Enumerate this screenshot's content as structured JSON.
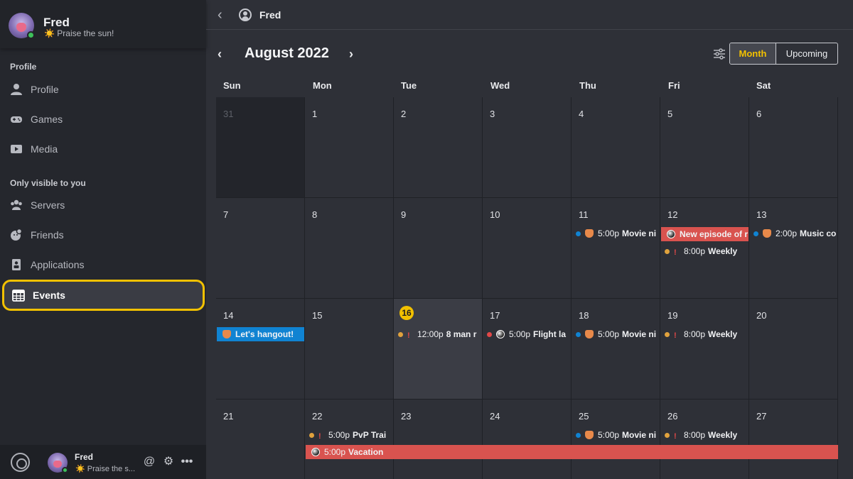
{
  "sidebar": {
    "profile": {
      "name": "Fred",
      "status": "Praise the sun!",
      "status_icon": "☀️"
    },
    "sections": [
      {
        "label": "Profile",
        "items": [
          {
            "label": "Profile",
            "icon": "person-icon"
          },
          {
            "label": "Games",
            "icon": "gamepad-icon"
          },
          {
            "label": "Media",
            "icon": "media-icon"
          }
        ]
      },
      {
        "label": "Only visible to you",
        "items": [
          {
            "label": "Servers",
            "icon": "servers-icon"
          },
          {
            "label": "Friends",
            "icon": "friends-icon"
          },
          {
            "label": "Applications",
            "icon": "applications-icon"
          },
          {
            "label": "Events",
            "icon": "calendar-icon",
            "active": true
          }
        ]
      }
    ],
    "footer": {
      "name": "Fred",
      "status": "Praise the s..."
    }
  },
  "topbar": {
    "name": "Fred"
  },
  "calendar": {
    "month_title": "August 2022",
    "view_options": [
      "Month",
      "Upcoming"
    ],
    "selected_view": "Month",
    "weekdays": [
      "Sun",
      "Mon",
      "Tue",
      "Wed",
      "Thu",
      "Fri",
      "Sat"
    ],
    "weeks": [
      [
        "31",
        "1",
        "2",
        "3",
        "4",
        "5",
        "6"
      ],
      [
        "7",
        "8",
        "9",
        "10",
        "11",
        "12",
        "13"
      ],
      [
        "14",
        "15",
        "16",
        "17",
        "18",
        "19",
        "20"
      ],
      [
        "21",
        "22",
        "23",
        "24",
        "25",
        "26",
        "27"
      ]
    ],
    "today": "16",
    "events": {
      "w2_thu": {
        "time": "5:00p",
        "title": "Movie ni"
      },
      "w2_fri_bar": {
        "title": "New episode of r"
      },
      "w2_fri": {
        "time": "8:00p",
        "title": "Weekly"
      },
      "w2_sat": {
        "time": "2:00p",
        "title": "Music co"
      },
      "w3_sun_bar": {
        "title": "Let's hangout!"
      },
      "w3_tue": {
        "time": "12:00p",
        "title": "8 man r"
      },
      "w3_wed": {
        "time": "5:00p",
        "title": "Flight la"
      },
      "w3_thu": {
        "time": "5:00p",
        "title": "Movie ni"
      },
      "w3_fri": {
        "time": "8:00p",
        "title": "Weekly"
      },
      "w4_mon": {
        "time": "5:00p",
        "title": "PvP Trai"
      },
      "w4_thu": {
        "time": "5:00p",
        "title": "Movie ni"
      },
      "w4_fri": {
        "time": "8:00p",
        "title": "Weekly"
      },
      "w4_vacation": {
        "time": "5:00p",
        "title": "Vacation"
      }
    },
    "colors": {
      "accent": "#f2c100",
      "blue": "#1083d2",
      "red": "#d9534f",
      "orange": "#e0a23d",
      "dot_red": "#e14848"
    }
  }
}
